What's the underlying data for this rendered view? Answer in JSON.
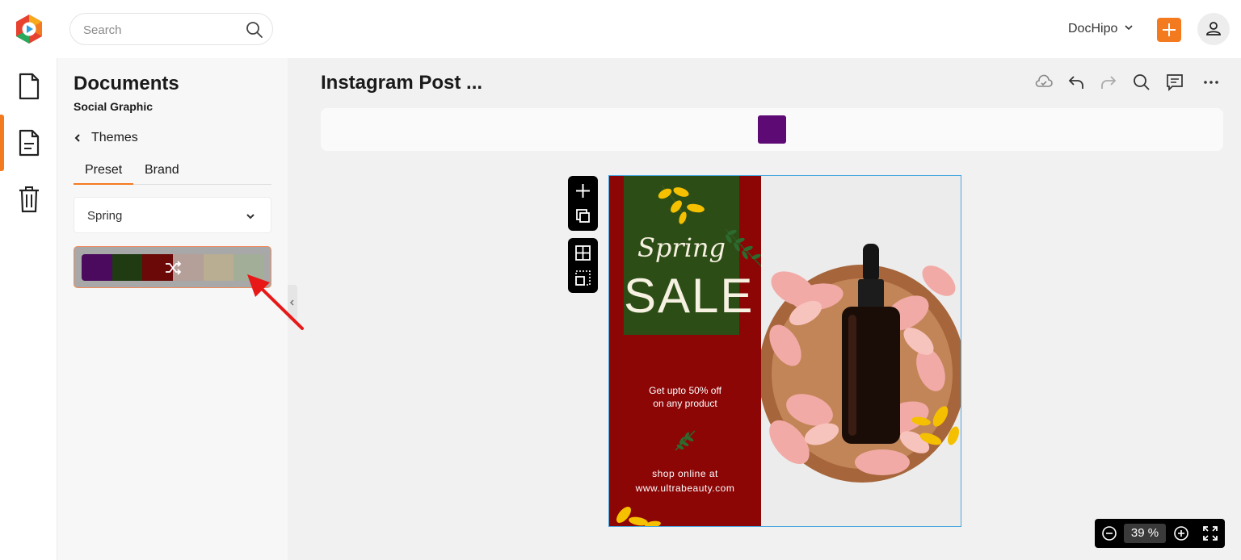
{
  "topbar": {
    "search_placeholder": "Search",
    "account_name": "DocHipo"
  },
  "panel": {
    "title": "Documents",
    "subtitle": "Social Graphic",
    "back_label": "Themes",
    "tabs": [
      "Preset",
      "Brand"
    ],
    "theme_select": "Spring",
    "palette": [
      "#4b0a5e",
      "#203a12",
      "#6b0808",
      "#b59f99",
      "#b9ae92",
      "#a3ae99"
    ]
  },
  "main": {
    "doc_title": "Instagram Post ...",
    "selected_color": "#5e0a75",
    "zoom_value": "39 %"
  },
  "design": {
    "colors": {
      "red": "#8c0606",
      "green": "#2d4d16",
      "accent": "#f5c000"
    },
    "script_title": "Spring",
    "headline": "SALE",
    "promo_line1": "Get upto 50% off",
    "promo_line2": "on any product",
    "shop_line1": "shop online at",
    "shop_line2": "www.ultrabeauty.com"
  },
  "colors": {
    "brand_orange": "#f47a20"
  }
}
